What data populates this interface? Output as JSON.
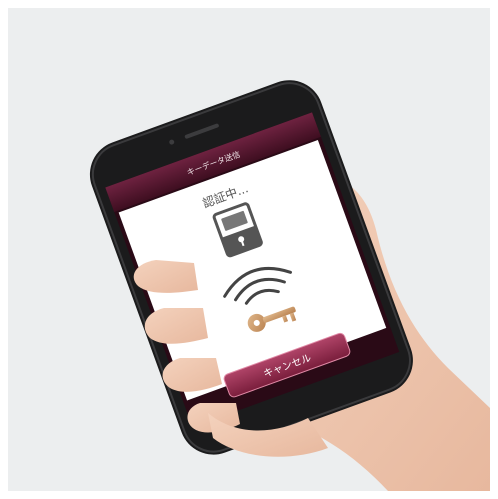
{
  "photo": {
    "subject": "hand-holding-smartphone"
  },
  "app": {
    "header_title": "キーデータ送信",
    "status_text": "認証中...",
    "cancel_label": "キャンセル",
    "colors": {
      "header_bg": "#5a1830",
      "button_bg": "#8e2a48",
      "screen_bg": "#ffffff",
      "lock_color": "#505050",
      "key_color": "#c99a6a"
    }
  }
}
